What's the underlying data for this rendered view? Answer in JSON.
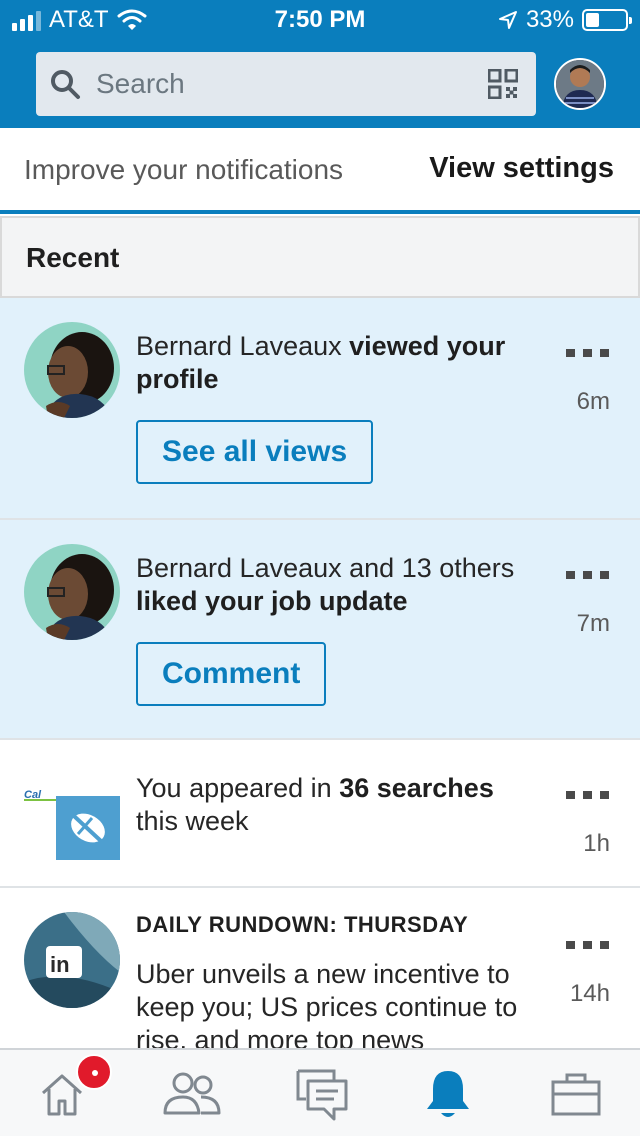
{
  "status_bar": {
    "carrier": "AT&T",
    "time": "7:50 PM",
    "battery": "33%",
    "battery_level": 0.33
  },
  "search": {
    "placeholder": "Search"
  },
  "settings_bar": {
    "text": "Improve your notifications",
    "link": "View settings"
  },
  "section": {
    "title": "Recent"
  },
  "notifications": [
    {
      "name": "Bernard Laveaux",
      "action": "viewed your profile",
      "time": "6m",
      "button": "See all views",
      "unread": true
    },
    {
      "name": "Bernard Laveaux and 13 others",
      "action": "liked your job update",
      "time": "7m",
      "button": "Comment",
      "unread": true
    },
    {
      "prefix": "You appeared in",
      "highlight": "36 searches",
      "suffix": "this week",
      "time": "1h",
      "unread": false
    },
    {
      "overline": "DAILY RUNDOWN: THURSDAY",
      "text": "Uber unveils a new incentive to keep you; US prices continue to rise, and more top news",
      "time": "14h",
      "unread": false
    }
  ],
  "tabbar": {
    "items": [
      "home-icon",
      "my-network-icon",
      "messaging-icon",
      "notifications-icon",
      "jobs-icon"
    ],
    "active": "notifications-icon"
  },
  "colors": {
    "brand": "#0a7ebd",
    "unread_bg": "#e1f1fb",
    "badge": "#e11a2b"
  }
}
